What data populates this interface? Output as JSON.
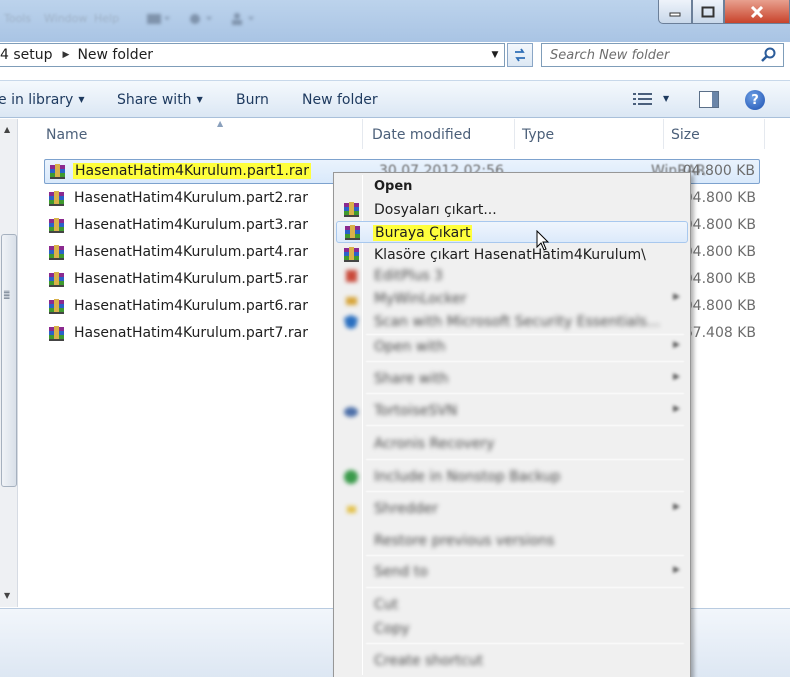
{
  "titlebar": {
    "menu": [
      "Tools",
      "Window",
      "Help"
    ],
    "colors": {
      "close": "#c8432b"
    }
  },
  "address": {
    "crumbs": [
      "4 setup",
      "New folder"
    ],
    "search_placeholder": "Search New folder"
  },
  "toolbar": {
    "include_library": "e in library",
    "share_with": "Share with",
    "burn": "Burn",
    "new_folder": "New folder",
    "help": "?"
  },
  "columns": {
    "name": "Name",
    "date": "Date modified",
    "type": "Type",
    "size": "Size"
  },
  "files": [
    {
      "name": "HasenatHatim4Kurulum.part1.rar",
      "date": "30.07.2012 02:56",
      "type": "WinRAR",
      "size": "04.800 KB"
    },
    {
      "name": "HasenatHatim4Kurulum.part2.rar",
      "size": "04.800 KB"
    },
    {
      "name": "HasenatHatim4Kurulum.part3.rar",
      "size": "04.800 KB"
    },
    {
      "name": "HasenatHatim4Kurulum.part4.rar",
      "size": "04.800 KB"
    },
    {
      "name": "HasenatHatim4Kurulum.part5.rar",
      "size": "04.800 KB"
    },
    {
      "name": "HasenatHatim4Kurulum.part6.rar",
      "size": "04.800 KB"
    },
    {
      "name": "HasenatHatim4Kurulum.part7.rar",
      "size": "67.408 KB"
    }
  ],
  "context_menu": {
    "open": "Open",
    "extract_files": "Dosyaları çıkart...",
    "extract_here": "Buraya Çıkart",
    "extract_to": "Klasöre çıkart HasenatHatim4Kurulum\\",
    "blurred": [
      "EditPlus 3",
      "MyWinLocker",
      "Scan with Microsoft Security Essentials...",
      "Open with",
      "Share with",
      "TortoiseSVN",
      "Acronis Recovery",
      "Include in Nonstop Backup",
      "Shredder",
      "Restore previous versions",
      "Send to",
      "Cut",
      "Copy",
      "Create shortcut"
    ]
  }
}
